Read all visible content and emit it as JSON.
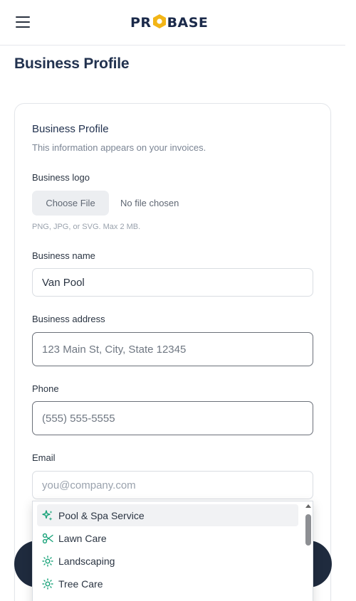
{
  "header": {
    "brand_left": "PR",
    "brand_right": "BASE",
    "brand_color": "#1b2a4a",
    "brand_accent": "#f2b517",
    "menu_icon": "hamburger-menu-icon"
  },
  "page": {
    "title": "Business Profile"
  },
  "profile": {
    "title": "Business Profile",
    "subtitle": "This information appears on your invoices.",
    "logo_label": "Business logo",
    "choose_file_label": "Choose File",
    "file_status": "No file chosen",
    "file_hint": "PNG, JPG, or SVG. Max 2 MB.",
    "name_label": "Business name",
    "name_value": "Van Pool",
    "address_label": "Business address",
    "address_placeholder": "123 Main St, City, State 12345",
    "phone_label": "Phone",
    "phone_placeholder": "(555) 555-5555",
    "email_label": "Email",
    "email_placeholder": "you@company.com"
  },
  "service_dropdown": {
    "items": [
      {
        "label": "Pool & Spa Service",
        "icon": "sparkles-icon",
        "selected": true
      },
      {
        "label": "Lawn Care",
        "icon": "scissors-icon",
        "selected": false
      },
      {
        "label": "Landscaping",
        "icon": "sun-icon",
        "selected": false
      },
      {
        "label": "Tree Care",
        "icon": "sun-icon",
        "selected": false
      }
    ],
    "icon_color": "#1aa37a"
  }
}
